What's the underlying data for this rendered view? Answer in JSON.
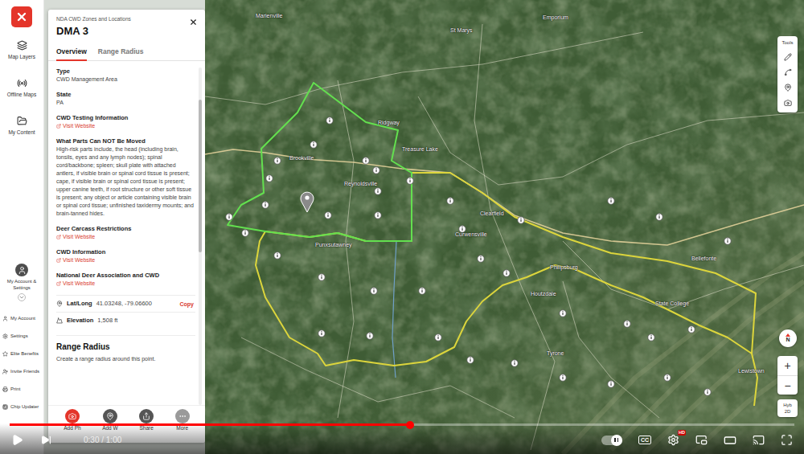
{
  "app": {
    "nav": [
      {
        "label": "Map Layers"
      },
      {
        "label": "Offline Maps"
      },
      {
        "label": "My Content"
      }
    ],
    "account": {
      "label": "My Account & Settings"
    },
    "menu": [
      {
        "label": "My Account"
      },
      {
        "label": "Settings"
      },
      {
        "label": "Elite Benefits"
      },
      {
        "label": "Invite Friends"
      },
      {
        "label": "Print"
      },
      {
        "label": "Chip Updater"
      }
    ]
  },
  "panel": {
    "subtitle": "NDA CWD Zones and Locations",
    "title": "DMA 3",
    "tabs": [
      {
        "label": "Overview",
        "selected": true
      },
      {
        "label": "Range Radius",
        "selected": false
      }
    ],
    "fields": [
      {
        "kind": "value",
        "label": "Type",
        "value": "CWD Management Area"
      },
      {
        "kind": "value",
        "label": "State",
        "value": "PA"
      },
      {
        "kind": "link",
        "label": "CWD Testing Information",
        "value": "Visit Website"
      },
      {
        "kind": "paragraph",
        "label": "What Parts Can NOT Be Moved",
        "value": "High-risk parts include, the head (including brain, tonsils, eyes and any lymph nodes); spinal cord/backbone; spleen; skull plate with attached antlers, if visible brain or spinal cord tissue is present; cape, if visible brain or spinal cord tissue is present; upper canine teeth, if root structure or other soft tissue is present; any object or article containing visible brain or spinal cord tissue; unfinished taxidermy mounts; and brain-tanned hides."
      },
      {
        "kind": "link",
        "label": "Deer Carcass Restrictions",
        "value": "Visit Website"
      },
      {
        "kind": "link",
        "label": "CWD Information",
        "value": "Visit Website"
      },
      {
        "kind": "link",
        "label": "National Deer Association and CWD",
        "value": "Visit Website"
      }
    ],
    "info": [
      {
        "kind": "location",
        "label": "Lat/Long",
        "value": "41.03248, -79.06600",
        "action": "Copy"
      },
      {
        "kind": "elevation",
        "label": "Elevation",
        "value": "1,508 ft"
      }
    ],
    "range": {
      "title": "Range Radius",
      "description": "Create a range radius around this point."
    },
    "actions": [
      {
        "kind": "photo",
        "label": "Add Ph"
      },
      {
        "kind": "waypoint",
        "label": "Add W"
      },
      {
        "kind": "share",
        "label": "Share"
      },
      {
        "kind": "more",
        "label": "More"
      }
    ]
  },
  "map": {
    "zones": [
      {
        "color": "#63e04f"
      },
      {
        "color": "#dcd53c"
      }
    ],
    "labels": [
      "Marienville",
      "Emporium",
      "St Marys",
      "Ridgway",
      "Brookville",
      "Treasure Lake",
      "Reynoldsville",
      "Punxsutawney",
      "Clearfield",
      "Curwensville",
      "Philipsburg",
      "Houtzdale",
      "Bellefonte",
      "State College",
      "Tyrone",
      "Lewistown"
    ],
    "tools": {
      "title": "Tools"
    },
    "compass": "N",
    "zoom": [
      "+",
      "−"
    ],
    "basemap": [
      "Hyb",
      "2D"
    ]
  },
  "video": {
    "progress": {
      "level": 0.51
    },
    "time": "0:30 / 1:00",
    "autoplay": {
      "on": true
    },
    "captions": "CC",
    "quality": "HD"
  }
}
